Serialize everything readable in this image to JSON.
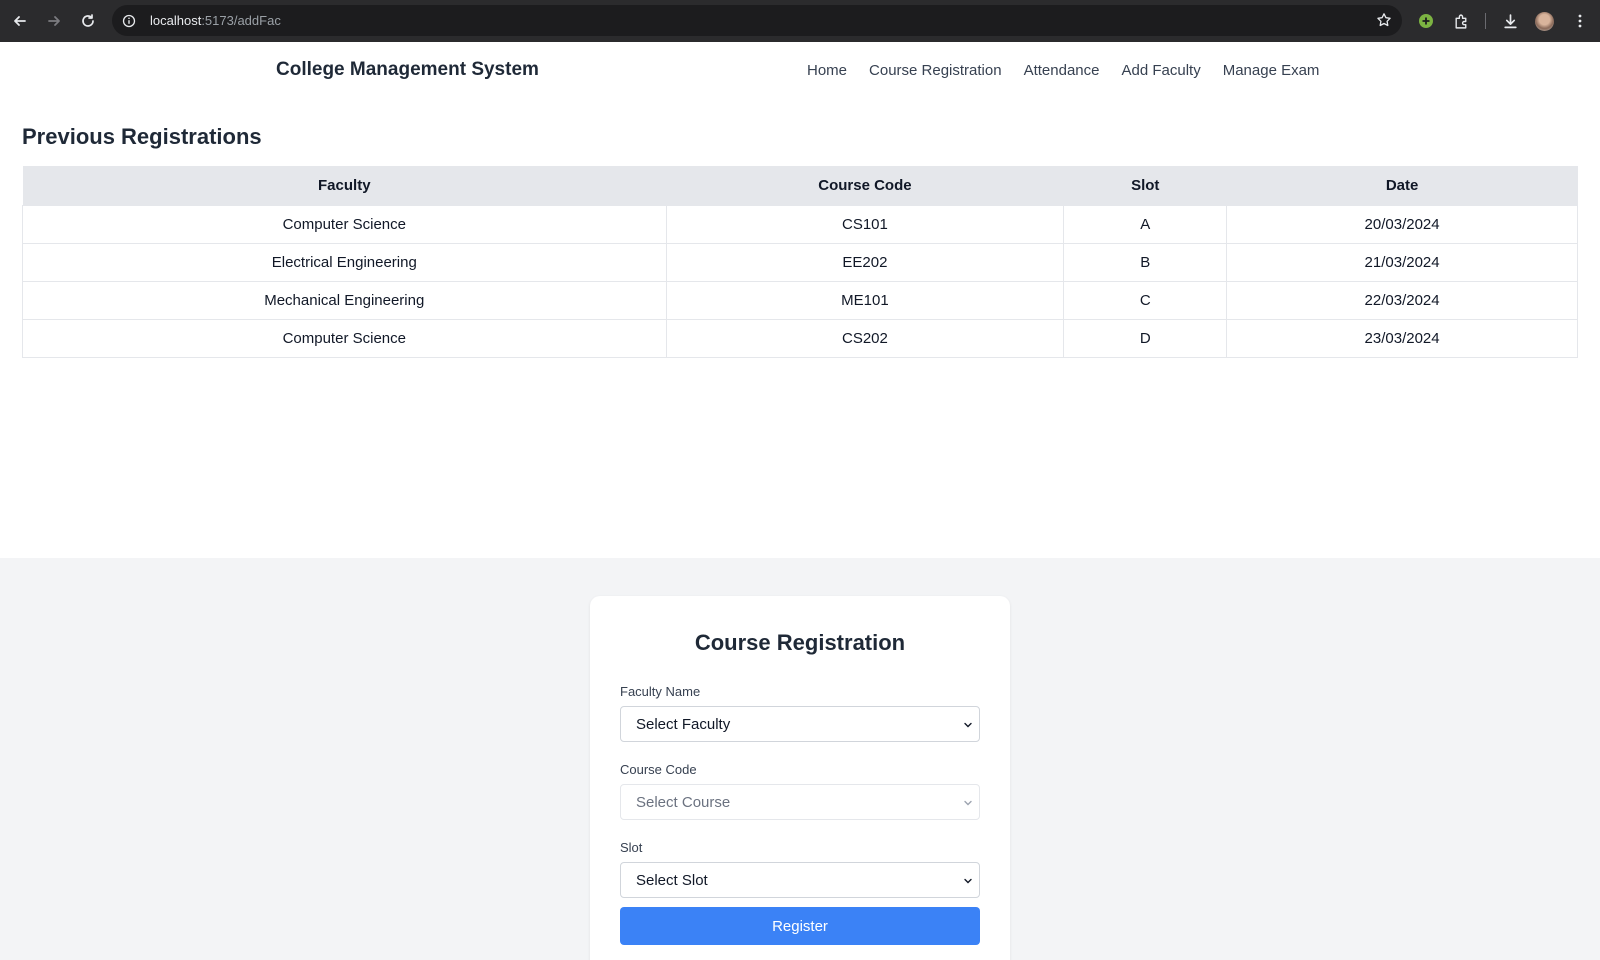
{
  "browser": {
    "url_host": "localhost",
    "url_path": ":5173/addFac"
  },
  "header": {
    "brand": "College Management System",
    "nav": [
      "Home",
      "Course Registration",
      "Attendance",
      "Add Faculty",
      "Manage Exam"
    ]
  },
  "previous": {
    "title": "Previous Registrations",
    "columns": [
      "Faculty",
      "Course Code",
      "Slot",
      "Date"
    ],
    "rows": [
      [
        "Computer Science",
        "CS101",
        "A",
        "20/03/2024"
      ],
      [
        "Electrical Engineering",
        "EE202",
        "B",
        "21/03/2024"
      ],
      [
        "Mechanical Engineering",
        "ME101",
        "C",
        "22/03/2024"
      ],
      [
        "Computer Science",
        "CS202",
        "D",
        "23/03/2024"
      ]
    ]
  },
  "form": {
    "title": "Course Registration",
    "faculty_label": "Faculty Name",
    "faculty_value": "Select Faculty",
    "course_label": "Course Code",
    "course_value": "Select Course",
    "slot_label": "Slot",
    "slot_value": "Select Slot",
    "submit_label": "Register"
  },
  "colors": {
    "accent": "#3b82f6",
    "table_header": "#e5e7eb",
    "form_background": "#f3f4f6"
  }
}
